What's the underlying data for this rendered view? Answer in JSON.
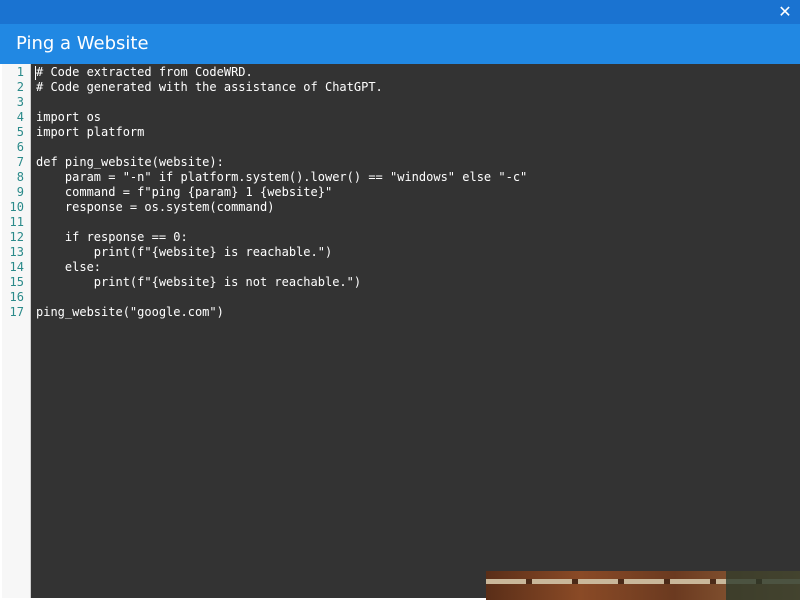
{
  "window": {
    "title": "Ping a Website",
    "close_symbol": "✕"
  },
  "editor": {
    "line_numbers": [
      "1",
      "2",
      "3",
      "4",
      "5",
      "6",
      "7",
      "8",
      "9",
      "10",
      "11",
      "12",
      "13",
      "14",
      "15",
      "16",
      "17"
    ],
    "lines": [
      "# Code extracted from CodeWRD.",
      "# Code generated with the assistance of ChatGPT.",
      "",
      "import os",
      "import platform",
      "",
      "def ping_website(website):",
      "    param = \"-n\" if platform.system().lower() == \"windows\" else \"-c\"",
      "    command = f\"ping {param} 1 {website}\"",
      "    response = os.system(command)",
      "",
      "    if response == 0:",
      "        print(f\"{website} is reachable.\")",
      "    else:",
      "        print(f\"{website} is not reachable.\")",
      "",
      "ping_website(\"google.com\")"
    ]
  },
  "colors": {
    "topbar": "#1a73d1",
    "titlebar": "#2188e3",
    "editor_bg": "#333333",
    "gutter_bg": "#f7f7f7",
    "line_number": "#2a8a8a"
  }
}
